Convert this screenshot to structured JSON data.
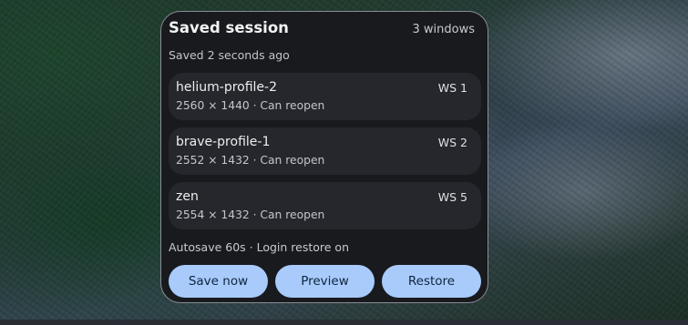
{
  "panel": {
    "title": "Saved session",
    "window_count": "3 windows",
    "saved_status": "Saved 2 seconds ago"
  },
  "sessions": [
    {
      "name": "helium-profile-2",
      "details": "2560 × 1440 · Can reopen",
      "workspace": "WS 1"
    },
    {
      "name": "brave-profile-1",
      "details": "2552 × 1432 · Can reopen",
      "workspace": "WS 2"
    },
    {
      "name": "zen",
      "details": "2554 × 1432 · Can reopen",
      "workspace": "WS 5"
    }
  ],
  "footer": {
    "status": "Autosave 60s · Login restore on"
  },
  "actions": {
    "save_label": "Save now",
    "preview_label": "Preview",
    "restore_label": "Restore"
  },
  "colors": {
    "panel_bg": "#191a1e",
    "item_bg": "#26272c",
    "button_bg": "#a8cbfb",
    "button_text": "#0f2540"
  }
}
